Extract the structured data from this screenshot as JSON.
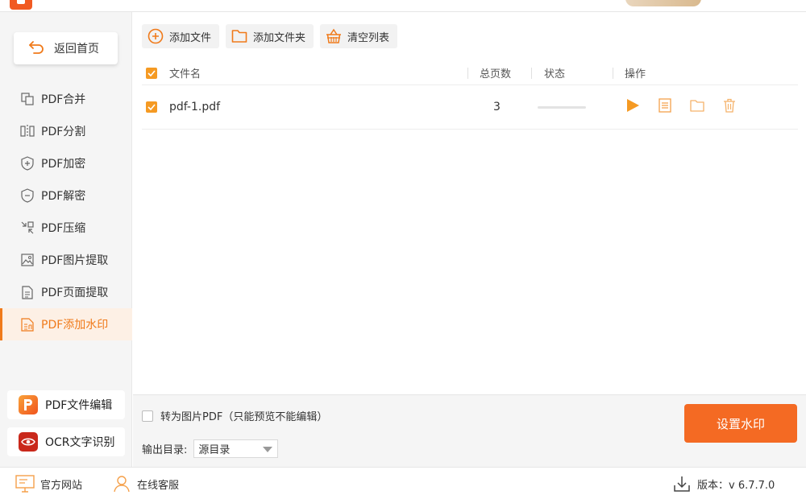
{
  "window": {
    "title": ""
  },
  "sidebar": {
    "home_label": "返回首页",
    "items": [
      {
        "label": "PDF合并",
        "icon": "merge-icon"
      },
      {
        "label": "PDF分割",
        "icon": "split-icon"
      },
      {
        "label": "PDF加密",
        "icon": "shield-plus-icon"
      },
      {
        "label": "PDF解密",
        "icon": "shield-minus-icon"
      },
      {
        "label": "PDF压缩",
        "icon": "compress-icon"
      },
      {
        "label": "PDF图片提取",
        "icon": "image-icon"
      },
      {
        "label": "PDF页面提取",
        "icon": "page-icon"
      },
      {
        "label": "PDF添加水印",
        "icon": "watermark-icon",
        "active": true
      }
    ],
    "promos": [
      {
        "label": "PDF文件编辑",
        "icon": "pdf-editor-icon"
      },
      {
        "label": "OCR文字识别",
        "icon": "ocr-eye-icon"
      }
    ]
  },
  "toolbar": {
    "add_file": "添加文件",
    "add_folder": "添加文件夹",
    "clear_list": "清空列表"
  },
  "table": {
    "columns": {
      "name": "文件名",
      "pages": "总页数",
      "status": "状态",
      "actions": "操作"
    },
    "rows": [
      {
        "name": "pdf-1.pdf",
        "pages": "3",
        "checked": true,
        "progress": 0
      }
    ]
  },
  "options": {
    "convert_to_image_label": "转为图片PDF（只能预览不能编辑）",
    "output_dir_label": "输出目录:",
    "output_dir_value": "源目录"
  },
  "primary_button": "设置水印",
  "footer": {
    "website": "官方网站",
    "support": "在线客服",
    "version": "版本：v 6.7.7.0"
  },
  "colors": {
    "accent": "#f07a1a",
    "primary_button": "#f46a23",
    "checkbox": "#f59a23",
    "sidebar_bg": "#f5f5f5"
  }
}
